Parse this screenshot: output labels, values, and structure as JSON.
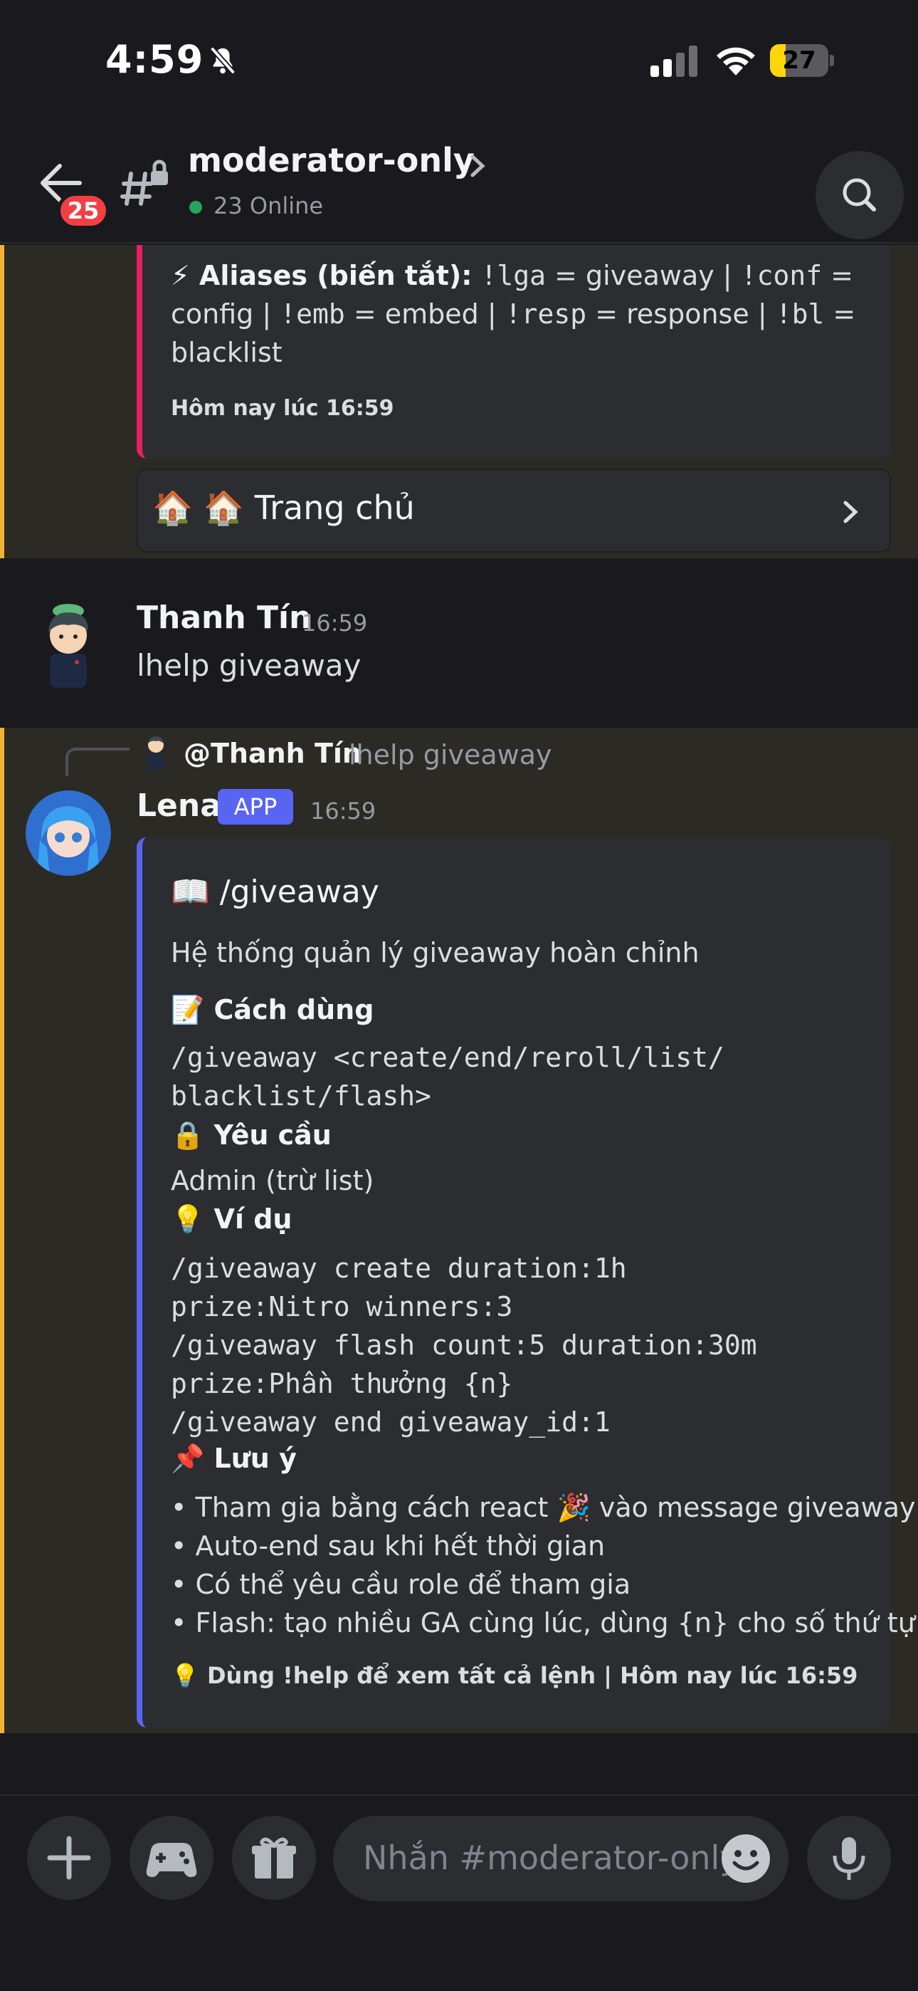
{
  "status": {
    "time": "4:59",
    "battery": "27",
    "battery_level": 0.27
  },
  "header": {
    "channel_name": "moderator-only",
    "online": "23 Online",
    "back_badge": "25"
  },
  "top_embed": {
    "aliases_label": "⚡ Aliases (biến tắt):",
    "aliases_parts": [
      {
        "code": "!lga",
        "text": " = giveaway | "
      },
      {
        "code": "!conf",
        "text": " = config | "
      },
      {
        "code": "!emb",
        "text": " = embed | "
      },
      {
        "code": "!resp",
        "text": " = response | "
      },
      {
        "code": "!bl",
        "text": " = blacklist"
      }
    ],
    "footer": "Hôm nay lúc 16:59",
    "home_button": "🏠  🏠 Trang chủ"
  },
  "user_message": {
    "author": "Thanh Tín",
    "time": "16:59",
    "content": "lhelp giveaway"
  },
  "bot_message": {
    "reply_author": "@Thanh Tín",
    "reply_text": "lhelp giveaway",
    "author": "Lena",
    "badge": "APP",
    "time": "16:59",
    "embed": {
      "title": "📖 /giveaway",
      "description": "Hệ thống quản lý giveaway hoàn chỉnh",
      "usage_label": "📝 Cách dùng",
      "usage_code": "/giveaway <create/end/reroll/list/\nblacklist/flash>",
      "requirements_label": "🔒 Yêu cầu",
      "requirements": "Admin (trừ list)",
      "example_label": "💡 Ví dụ",
      "example_code": "/giveaway create duration:1h\nprize:Nitro winners:3\n/giveaway flash count:5 duration:30m\nprize:Phần thưởng {n}\n/giveaway end giveaway_id:1",
      "notes_label": "📌 Lưu ý",
      "notes": [
        "• Tham gia bằng cách react 🎉 vào message giveaway",
        "• Auto-end sau khi hết thời gian",
        "• Có thể yêu cầu role để tham gia",
        "• Flash: tạo nhiều GA cùng lúc, dùng {n} cho số thứ tự"
      ],
      "footer": "💡 Dùng !help để xem tất cả lệnh | Hôm nay lúc 16:59"
    }
  },
  "composer": {
    "placeholder": "Nhắn #moderator-only"
  },
  "colors": {
    "accent": "#5865f2",
    "pink_embed": "#e91e63",
    "gold_highlight": "#f0b232",
    "online": "#23a55a",
    "badge_red": "#f23f43"
  }
}
